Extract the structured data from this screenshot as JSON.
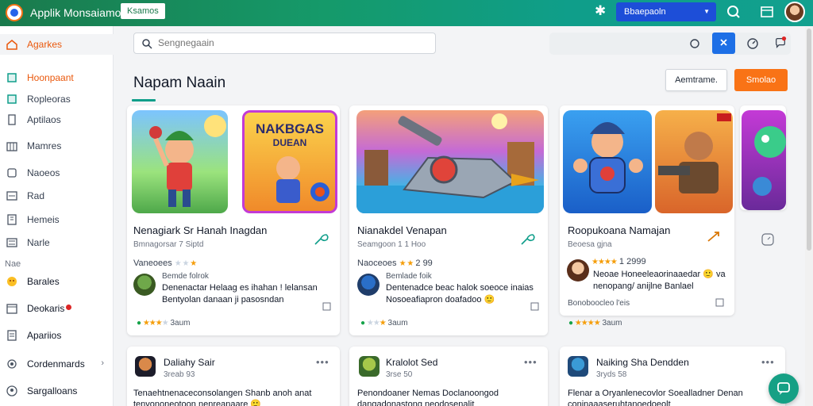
{
  "app": {
    "title": "Applik Monsaiamo",
    "badge": "Ksamos"
  },
  "topbar": {
    "search_value": "Bbaepaoln",
    "icons": [
      "star-icon",
      "search-icon",
      "window-icon",
      "avatar"
    ]
  },
  "sidebar": {
    "items": [
      {
        "label": "Agarkes",
        "icon": "home-icon",
        "active": true
      },
      {
        "label": "Hoonpaant",
        "icon": "bookmark-icon"
      },
      {
        "label": "Ropleoras",
        "icon": "folder-icon"
      },
      {
        "label": "Aptilaos",
        "icon": "doc-icon"
      },
      {
        "label": "Mamres",
        "icon": "grid-icon"
      },
      {
        "label": "Naoeos",
        "icon": "bag-icon"
      },
      {
        "label": "Rad",
        "icon": "list-icon"
      },
      {
        "label": "Hemeis",
        "icon": "building-icon"
      },
      {
        "label": "Narle",
        "icon": "menu-icon"
      }
    ],
    "section_label": "Nae",
    "items2": [
      {
        "label": "Barales",
        "icon": "emoji-icon"
      },
      {
        "label": "Deokaris",
        "icon": "calendar-icon",
        "dot": true
      },
      {
        "label": "Apariios",
        "icon": "page-icon"
      },
      {
        "label": "Cordenmards",
        "icon": "settings-icon",
        "arrow": "›"
      },
      {
        "label": "Sargalloans",
        "icon": "person-icon"
      }
    ]
  },
  "main": {
    "search_placeholder": "Sengnegaain",
    "page_title": "Napam Naain",
    "btn_outline": "Aemtrame.",
    "btn_orange": "Smolao"
  },
  "cards": [
    {
      "title": "Nenagiark Sr Hanah Inagdan",
      "sub": "Bmnagorsar 7 Siptd",
      "rating_label": "Vaneoees",
      "review_author": "Bemde folrok",
      "review_lines": [
        "Denenactar Helaag es ihahan !  lelansan",
        "Bentyolan danaan ji pasosndan"
      ],
      "foot": "3aum"
    },
    {
      "title": "Nianakdel Venapan",
      "sub": "Seamgoon 1 1 Hoo",
      "rating_label": "Naoceoes",
      "rating_value": "2 99",
      "review_author": "Bemlade foik",
      "review_lines": [
        "Dentenadce beac halok soeoce inaias",
        "Nosoeafiapron doafadoo 🙂"
      ],
      "foot": "3aum"
    },
    {
      "title": "Roopukoana Namajan",
      "sub": "Beoesa gjna",
      "rating_value": "1 2999",
      "review_lines": [
        "Neoae Honeeleaorinaaedar 🙂 va",
        "nenopang/ anijlne Banlael"
      ],
      "foot_text": "Bonoboocleo l'eis",
      "foot": "3aum"
    }
  ],
  "posts": [
    {
      "title": "Daliahy Sair",
      "sub": "3reab 93",
      "lines": [
        "Tenaehtnenaceconsolangen Shanb anoh anat",
        "tenvononeotoon nenreanaare 🙂"
      ]
    },
    {
      "title": "Kralolot Sed",
      "sub": "3rse 50",
      "lines": [
        "Penondoaner Nemas Doclanoongod",
        "dangadonastong neodosenalit"
      ]
    },
    {
      "title": "Naiking Sha Dendden",
      "sub": "3ryds 58",
      "lines": [
        "Flenar a Oryanlenecovlor Soealladner Denan",
        "coninaaaseruhtanoedoeolt"
      ]
    }
  ],
  "colors": {
    "accent": "#0f9e8a",
    "orange": "#f97316",
    "blue": "#1d6fe6"
  }
}
